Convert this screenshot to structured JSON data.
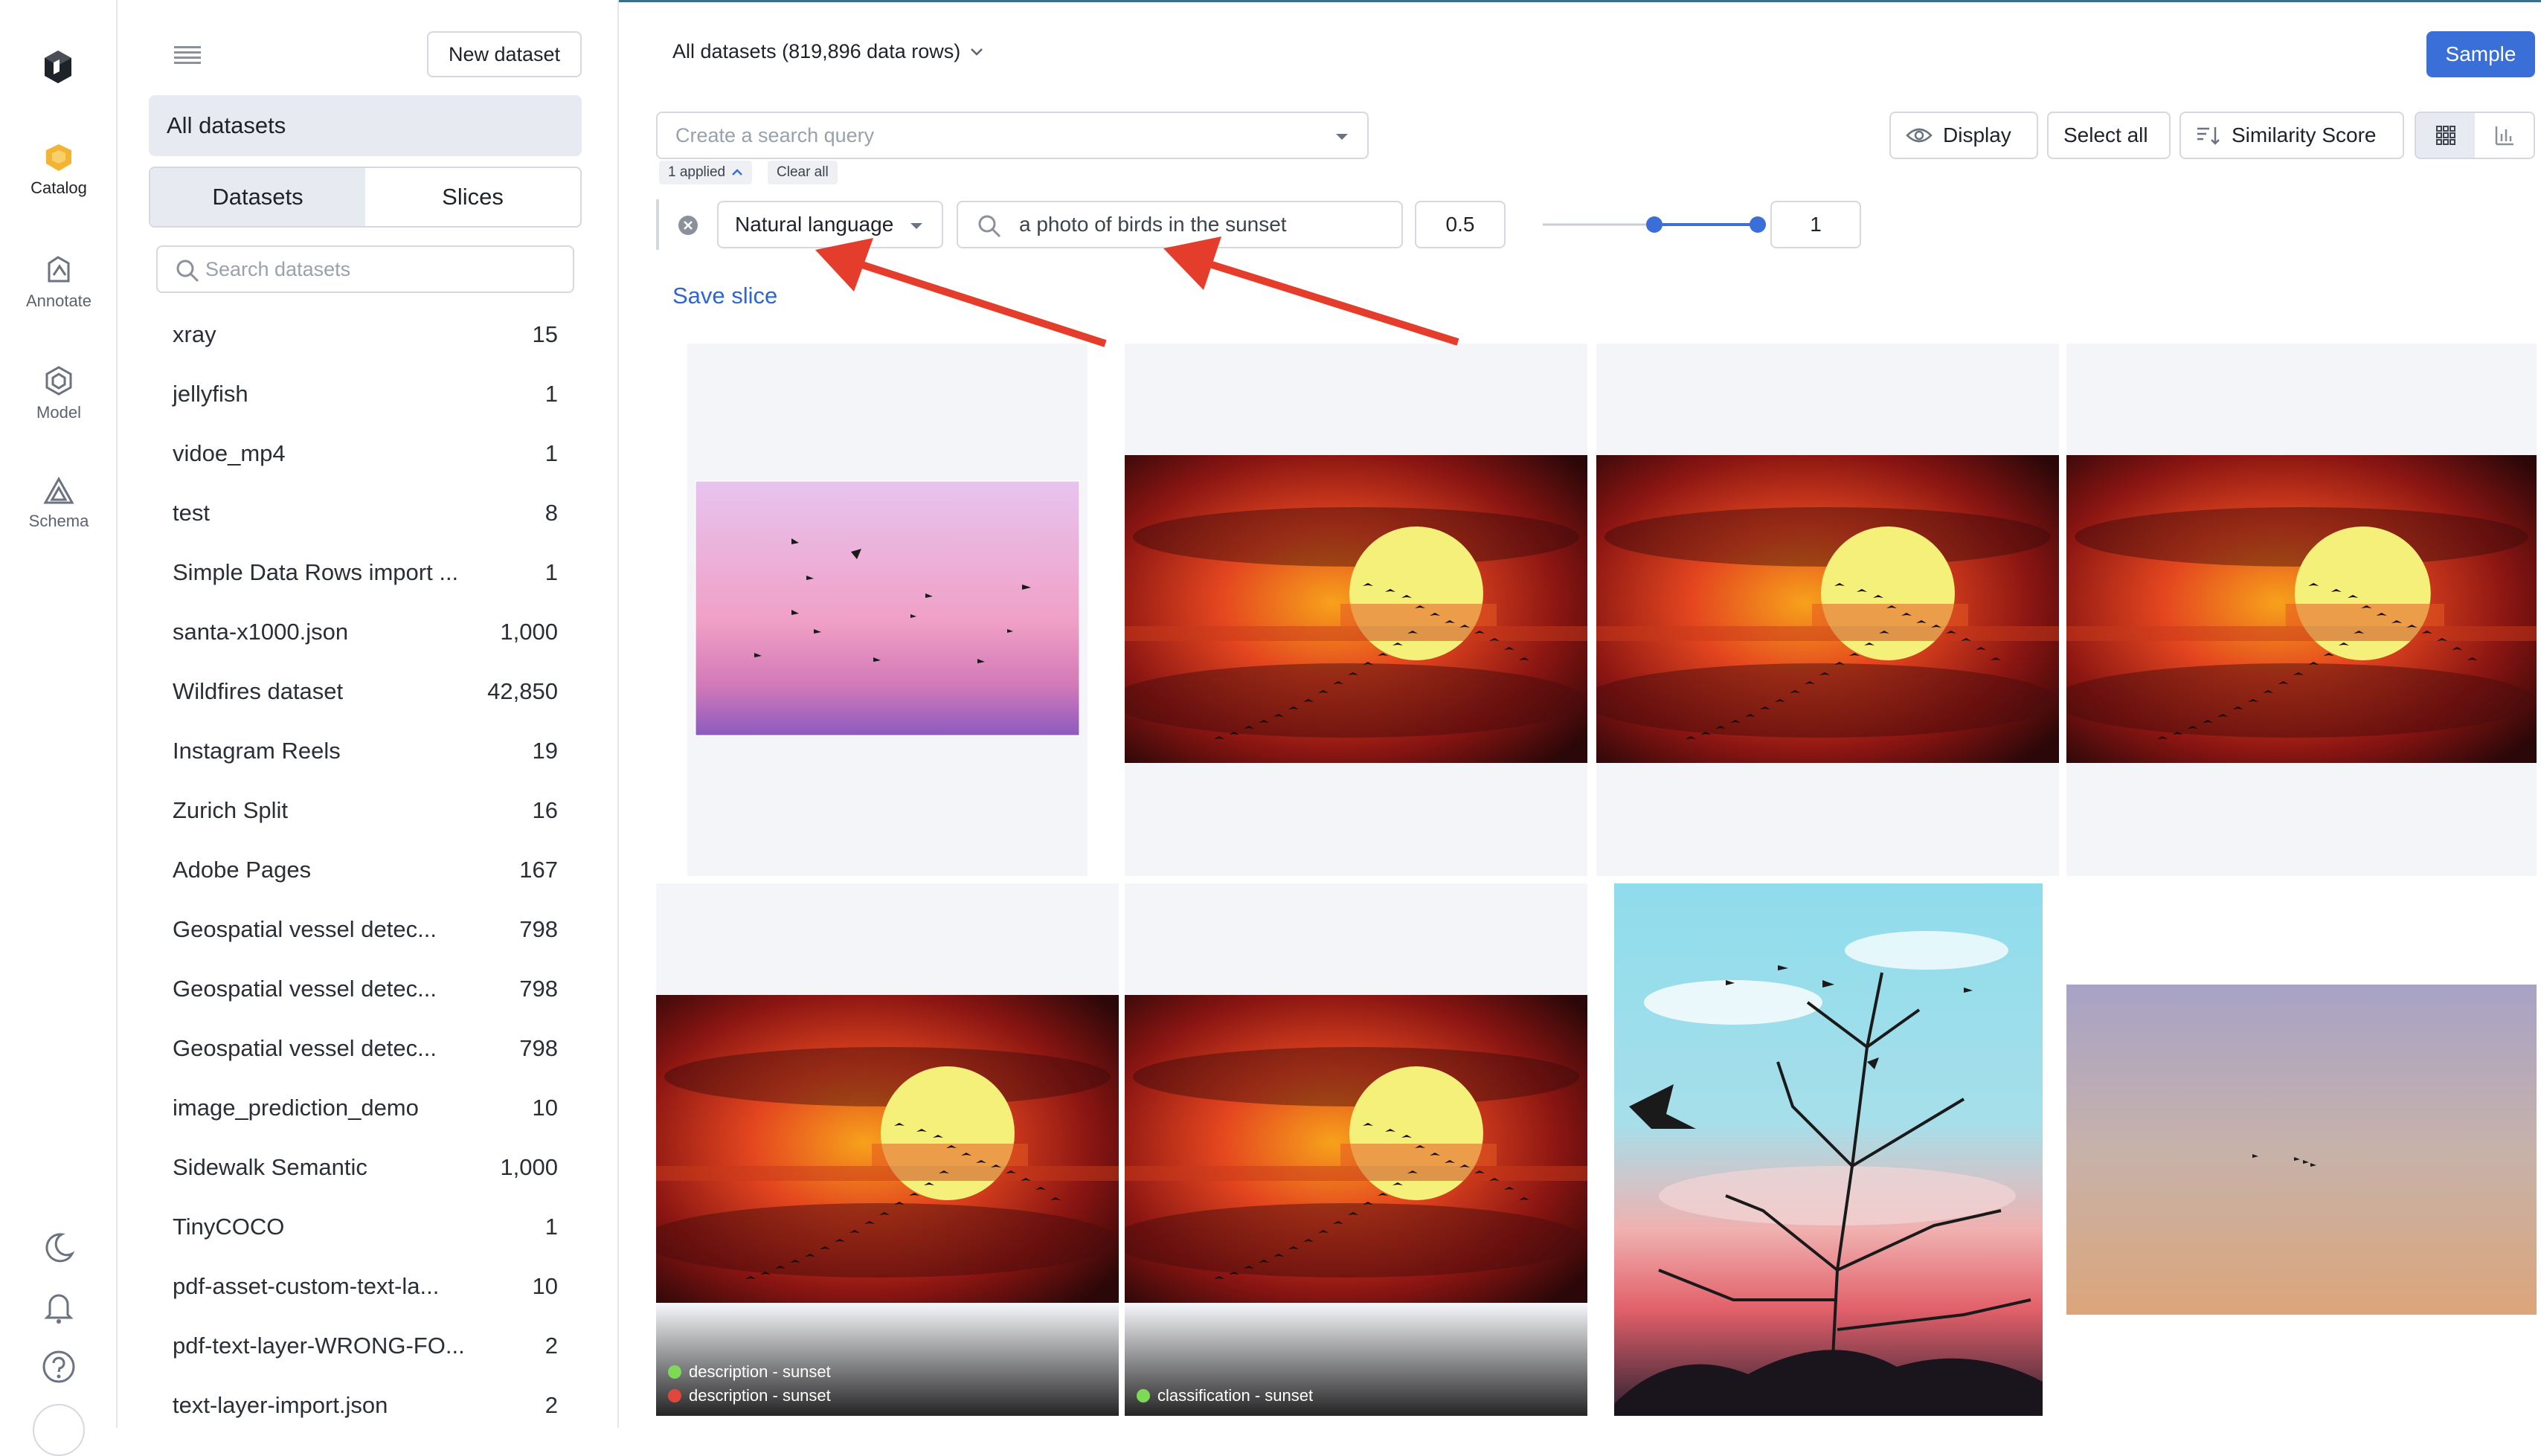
{
  "rail": {
    "items": [
      {
        "label": "Catalog"
      },
      {
        "label": "Annotate"
      },
      {
        "label": "Model"
      },
      {
        "label": "Schema"
      }
    ]
  },
  "sidebar": {
    "new_dataset_label": "New dataset",
    "all_datasets_label": "All datasets",
    "tabs": [
      "Datasets",
      "Slices"
    ],
    "search_placeholder": "Search datasets",
    "datasets": [
      {
        "name": "xray",
        "count": "15"
      },
      {
        "name": "jellyfish",
        "count": "1"
      },
      {
        "name": "vidoe_mp4",
        "count": "1"
      },
      {
        "name": "test",
        "count": "8"
      },
      {
        "name": "Simple Data Rows import ...",
        "count": "1"
      },
      {
        "name": "santa-x1000.json",
        "count": "1,000"
      },
      {
        "name": "Wildfires dataset",
        "count": "42,850"
      },
      {
        "name": "Instagram Reels",
        "count": "19"
      },
      {
        "name": "Zurich Split",
        "count": "16"
      },
      {
        "name": "Adobe Pages",
        "count": "167"
      },
      {
        "name": "Geospatial vessel detec...",
        "count": "798"
      },
      {
        "name": "Geospatial vessel detec...",
        "count": "798"
      },
      {
        "name": "Geospatial vessel detec...",
        "count": "798"
      },
      {
        "name": "image_prediction_demo",
        "count": "10"
      },
      {
        "name": "Sidewalk Semantic",
        "count": "1,000"
      },
      {
        "name": "TinyCOCO",
        "count": "1"
      },
      {
        "name": "pdf-asset-custom-text-la...",
        "count": "10"
      },
      {
        "name": "pdf-text-layer-WRONG-FO...",
        "count": "2"
      },
      {
        "name": "text-layer-import.json",
        "count": "2"
      }
    ]
  },
  "main": {
    "title": "All datasets (819,896 data rows)",
    "sample_label": "Sample",
    "query_placeholder": "Create a search query",
    "applied_label": "1 applied",
    "clear_all_label": "Clear all",
    "display_label": "Display",
    "select_all_label": "Select all",
    "sort_label": "Similarity Score",
    "filter_type": "Natural language",
    "filter_query": "a photo of birds in the sunset",
    "range_min": "0.5",
    "range_max": "1",
    "slider_range": [
      0.5,
      1
    ],
    "save_slice_label": "Save slice",
    "tiles": [
      {
        "tags": []
      },
      {
        "tags": []
      },
      {
        "tags": []
      },
      {
        "tags": []
      },
      {
        "tags": [
          {
            "text": "description - sunset",
            "color": "#7ed957"
          },
          {
            "text": "description - sunset",
            "color": "#e0463b"
          }
        ]
      },
      {
        "tags": [
          {
            "text": "classification - sunset",
            "color": "#7ed957"
          }
        ]
      },
      {
        "tags": []
      },
      {
        "tags": []
      }
    ]
  },
  "colors": {
    "accent": "#3a6fd8",
    "link": "#2f67c9",
    "arrow": "#e43d2b"
  }
}
